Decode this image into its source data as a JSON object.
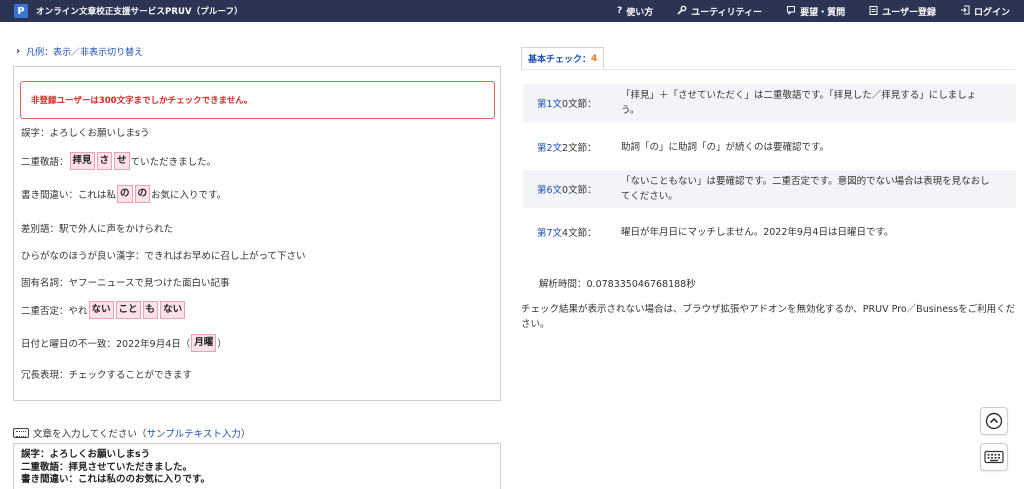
{
  "header": {
    "logo": "P",
    "brand": "オンライン文章校正支援サービスPRUV（プルーフ）",
    "nav": [
      {
        "icon": "question-icon",
        "label": "使い方"
      },
      {
        "icon": "wrench-icon",
        "label": "ユーティリティー"
      },
      {
        "icon": "feedback-icon",
        "label": "要望・質問"
      },
      {
        "icon": "clipboard-icon",
        "label": "ユーザー登録"
      },
      {
        "icon": "login-icon",
        "label": "ログイン"
      }
    ]
  },
  "legend": {
    "label": "凡例：表示／非表示切り替え"
  },
  "result": {
    "alert": "非登録ユーザーは300文字までしかチェックできません。",
    "lines": {
      "typo": "誤字：よろしくお願いしまsう",
      "double_keigo": {
        "prefix": "二重敬語：",
        "marks": [
          "拝見",
          "さ",
          "せ"
        ],
        "suffix": "ていただきました。"
      },
      "writing_error": {
        "prefix": "書き間違い：これは私",
        "marks": [
          "の",
          "の"
        ],
        "suffix": "お気に入りです。"
      },
      "discrimination": "差別語：駅で外人に声をかけられた",
      "hiragana": "ひらがなのほうが良い漢字：できればお早めに召し上がって下さい",
      "proper_noun": "固有名詞：ヤフーニュースで見つけた面白い記事",
      "double_negation": {
        "prefix": "二重否定：やれ",
        "marks": [
          "ない",
          "こと",
          "も",
          "ない"
        ]
      },
      "date_mismatch": {
        "prefix": "日付と曜日の不一致：2022年9月4日（",
        "mark": "月曜",
        "suffix": "）"
      },
      "redundant": "冗長表現：チェックすることができます"
    }
  },
  "input": {
    "label": "文章を入力してください（",
    "link": "サンプルテキスト入力",
    "label_end": "）",
    "text_lines": [
      "誤字：よろしくお願いしまsう",
      "二重敬語：拝見させていただきました。",
      "書き間違い：これは私ののお気に入りです。"
    ]
  },
  "checks": {
    "tab_label": "基本チェック：",
    "tab_count": "4",
    "rows": [
      {
        "pos_bold": "第1文",
        "pos_rest": "0文節：",
        "message": "「拝見」＋「させていただく」は二重敬語です。「拝見した／拝見する」にしましょう。"
      },
      {
        "pos_bold": "第2文",
        "pos_rest": "2文節：",
        "message": "助詞「の」に助詞「の」が続くのは要確認です。"
      },
      {
        "pos_bold": "第6文",
        "pos_rest": "0文節：",
        "message": "「ないこともない」は要確認です。二重否定です。意図的でない場合は表現を見なおしてください。"
      },
      {
        "pos_bold": "第7文",
        "pos_rest": "4文節：",
        "message": "曜日が年月日にマッチしません。2022年9月4日は日曜日です。"
      }
    ],
    "timing": "解析時間：0.078335046768188秒",
    "note": "チェック結果が表示されない場合は、ブラウザ拡張やアドオンを無効化するか、PRUV Pro／Businessをご利用ください。"
  },
  "floating": {
    "scroll_top_icon": "chevron-up-circle-icon",
    "keyboard_icon": "keyboard-icon"
  },
  "colors": {
    "header_bg": "#2b3553",
    "link_blue": "#1d4fb5",
    "alert_red": "#d92525",
    "highlight_bg": "#fbe1e8",
    "highlight_border": "#f0a0b4",
    "count_orange": "#e07a20"
  }
}
